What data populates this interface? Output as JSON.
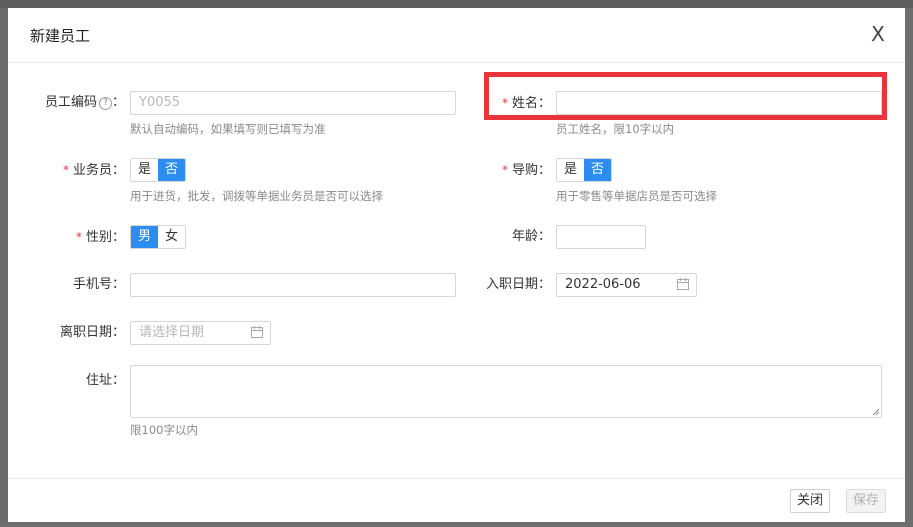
{
  "dialog": {
    "title": "新建员工",
    "close_glyph": "X"
  },
  "fields": {
    "employee_code": {
      "label": "员工编码",
      "help_glyph": "?",
      "placeholder": "Y0055",
      "help": "默认自动编码，如果填写则已填写为准"
    },
    "name": {
      "required_mark": "*",
      "label": "姓名",
      "value": "",
      "help": "员工姓名，限10字以内"
    },
    "salesperson": {
      "required_mark": "*",
      "label": "业务员",
      "options": [
        "是",
        "否"
      ],
      "selected": "否",
      "help": "用于进货，批发，调拨等单据业务员是否可以选择"
    },
    "guide": {
      "required_mark": "*",
      "label": "导购",
      "options": [
        "是",
        "否"
      ],
      "selected": "否",
      "help": "用于零售等单据店员是否可选择"
    },
    "gender": {
      "required_mark": "*",
      "label": "性别",
      "options": [
        "男",
        "女"
      ],
      "selected": "男"
    },
    "age": {
      "label": "年龄",
      "value": ""
    },
    "phone": {
      "label": "手机号",
      "value": ""
    },
    "hire_date": {
      "label": "入职日期",
      "value": "2022-06-06"
    },
    "leave_date": {
      "label": "离职日期",
      "placeholder": "请选择日期"
    },
    "address": {
      "label": "住址",
      "value": "",
      "help": "限100字以内"
    }
  },
  "colon": "：",
  "footer": {
    "close_label": "关闭",
    "save_label": "保存"
  },
  "colors": {
    "accent": "#2d8cf0",
    "required": "#e4393c",
    "highlight": "#e8343a"
  }
}
